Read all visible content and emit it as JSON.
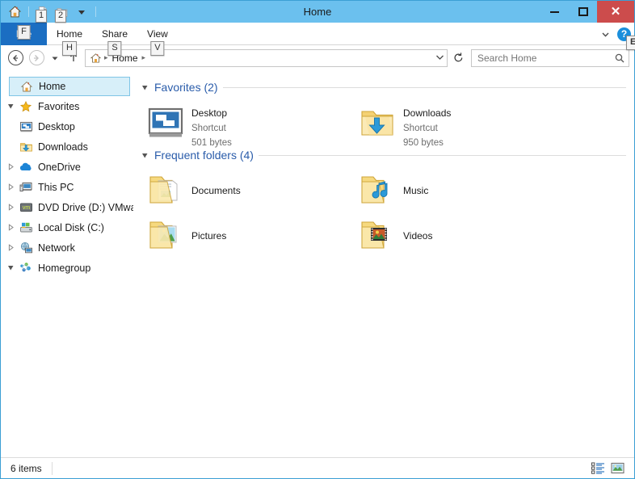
{
  "window": {
    "title": "Home",
    "minimize_label": "Minimize",
    "maximize_label": "Maximize",
    "close_label": "Close"
  },
  "quick_access": {
    "home_icon": "home-icon",
    "items": [
      {
        "icon": "properties-icon",
        "keytip": "1"
      },
      {
        "icon": "new-folder-icon",
        "keytip": "2"
      }
    ],
    "customize_label": "Customize Quick Access Toolbar",
    "dropdown_icon": "chevron-down-icon"
  },
  "ribbon": {
    "file_tab": {
      "label": "File",
      "keytip": "F"
    },
    "tabs": [
      {
        "label": "Home",
        "keytip": "H"
      },
      {
        "label": "Share",
        "keytip": "S"
      },
      {
        "label": "View",
        "keytip": "V"
      }
    ],
    "expand_icon": "chevron-down-icon",
    "help": {
      "glyph": "?",
      "keytip": "E"
    }
  },
  "navigation": {
    "back": {
      "icon": "arrow-left-icon",
      "glyph": "←",
      "enabled": true
    },
    "forward": {
      "icon": "arrow-right-icon",
      "glyph": "→",
      "enabled": false
    },
    "recent": {
      "icon": "chevron-down-icon",
      "glyph": "▾"
    },
    "up": {
      "icon": "arrow-up-icon",
      "glyph": "↑"
    },
    "refresh": {
      "icon": "refresh-icon",
      "glyph": "↻"
    }
  },
  "address": {
    "home_icon": "home-icon",
    "crumbs": [
      "Home"
    ],
    "separator": "▸",
    "dropdown_icon": "chevron-down-icon"
  },
  "search": {
    "placeholder": "Search Home",
    "value": "",
    "icon": "search-icon"
  },
  "sidebar": {
    "items": [
      {
        "label": "Home",
        "icon": "home-icon",
        "indent": 0,
        "twisty": "none",
        "selected": true
      },
      {
        "label": "Favorites",
        "icon": "star-icon",
        "indent": 0,
        "twisty": "expanded",
        "selected": false
      },
      {
        "label": "Desktop",
        "icon": "desktop-icon",
        "indent": 1,
        "twisty": "none",
        "selected": false
      },
      {
        "label": "Downloads",
        "icon": "download-icon",
        "indent": 1,
        "twisty": "none",
        "selected": false
      },
      {
        "label": "OneDrive",
        "icon": "cloud-icon",
        "indent": 0,
        "twisty": "collapsed",
        "selected": false
      },
      {
        "label": "This PC",
        "icon": "computer-icon",
        "indent": 0,
        "twisty": "collapsed",
        "selected": false
      },
      {
        "label": "DVD Drive (D:) VMwa",
        "icon": "dvd-drive-icon",
        "indent": 0,
        "twisty": "collapsed",
        "selected": false
      },
      {
        "label": "Local Disk (C:)",
        "icon": "hard-disk-icon",
        "indent": 0,
        "twisty": "collapsed",
        "selected": false
      },
      {
        "label": "Network",
        "icon": "network-icon",
        "indent": 0,
        "twisty": "collapsed",
        "selected": false
      },
      {
        "label": "Homegroup",
        "icon": "homegroup-icon",
        "indent": 0,
        "twisty": "expanded",
        "selected": false
      }
    ]
  },
  "main": {
    "sections": [
      {
        "title": "Favorites (2)",
        "items": [
          {
            "name": "Desktop",
            "type": "Shortcut",
            "size": "501 bytes",
            "icon": "desktop-shortcut-icon"
          },
          {
            "name": "Downloads",
            "type": "Shortcut",
            "size": "950 bytes",
            "icon": "downloads-folder-icon"
          }
        ]
      },
      {
        "title": "Frequent folders (4)",
        "items": [
          {
            "name": "Documents",
            "type": "",
            "size": "",
            "icon": "documents-folder-icon"
          },
          {
            "name": "Music",
            "type": "",
            "size": "",
            "icon": "music-folder-icon"
          },
          {
            "name": "Pictures",
            "type": "",
            "size": "",
            "icon": "pictures-folder-icon"
          },
          {
            "name": "Videos",
            "type": "",
            "size": "",
            "icon": "videos-folder-icon"
          }
        ]
      }
    ]
  },
  "status": {
    "item_count": "6 items",
    "views": [
      {
        "icon": "details-view-icon",
        "label": "Details view"
      },
      {
        "icon": "large-icons-view-icon",
        "label": "Large icons view"
      }
    ]
  },
  "colors": {
    "titlebar": "#6bc0ee",
    "file_tab": "#1b6ec2",
    "close_button": "#cc4c4c",
    "selection": "#d7eff9",
    "selection_border": "#7fc5e6",
    "section_heading": "#2a5caa",
    "folder_yellow": "#f8dd8a",
    "accent_blue": "#1b8fdc"
  }
}
